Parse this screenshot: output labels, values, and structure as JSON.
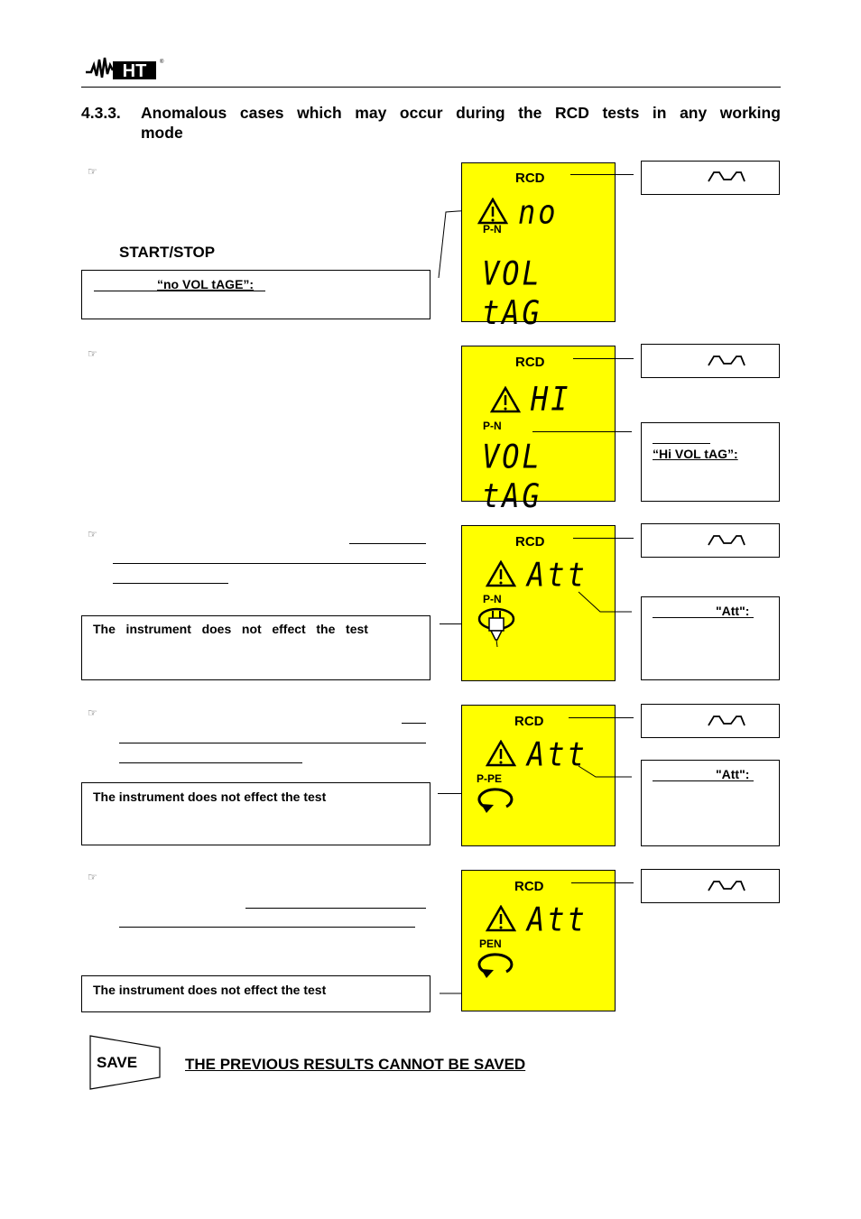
{
  "header": {
    "logo_text": "HT",
    "logo_registered": "®"
  },
  "section": {
    "number": "4.3.3.",
    "title_line1_words": [
      "Anomalous",
      "cases",
      "which",
      "may",
      "occur",
      "during",
      "the",
      "RCD",
      "tests",
      "in",
      "any",
      "working"
    ],
    "title_line2": "mode"
  },
  "note_icon": "pointing-hand-icon",
  "cases": [
    {
      "key_label": "START/STOP",
      "box_text": "“no VOL tAGE”:",
      "lcd": {
        "mode": "RCD",
        "phase": "P-N",
        "line1": "no",
        "line2": "VOL tAG"
      },
      "callouts": [
        {
          "icon": "waveform-icon",
          "text": ""
        }
      ]
    },
    {
      "lcd": {
        "mode": "RCD",
        "phase": "P-N",
        "line1": "HI",
        "line2": "VOL tAG"
      },
      "callouts": [
        {
          "icon": "waveform-icon",
          "text": ""
        },
        {
          "text": "“Hi VOL tAG”:"
        }
      ]
    },
    {
      "box_text": "The   instrument   does   not   effect   the   test",
      "lcd": {
        "mode": "RCD",
        "phase": "P-N",
        "line1": "Att",
        "icon": "plug-rotate-icon"
      },
      "callouts": [
        {
          "icon": "waveform-icon",
          "text": ""
        },
        {
          "text": "\"Att\":"
        }
      ]
    },
    {
      "box_text": "The instrument does not effect the test",
      "lcd": {
        "mode": "RCD",
        "phase": "P-PE",
        "line1": "Att",
        "icon": "rotate-arrow-icon"
      },
      "callouts": [
        {
          "icon": "waveform-icon",
          "text": ""
        },
        {
          "text": "\"Att\":"
        }
      ]
    },
    {
      "box_text": "The instrument does not effect the test",
      "lcd": {
        "mode": "RCD",
        "phase": "PEN",
        "line1": "Att",
        "icon": "rotate-arrow-icon"
      },
      "callouts": [
        {
          "icon": "waveform-icon",
          "text": ""
        }
      ]
    }
  ],
  "footer": {
    "save_key": "SAVE",
    "save_note": "THE PREVIOUS RESULTS CANNOT BE SAVED"
  },
  "colors": {
    "lcd_background": "#ffff00",
    "ink": "#000000"
  }
}
